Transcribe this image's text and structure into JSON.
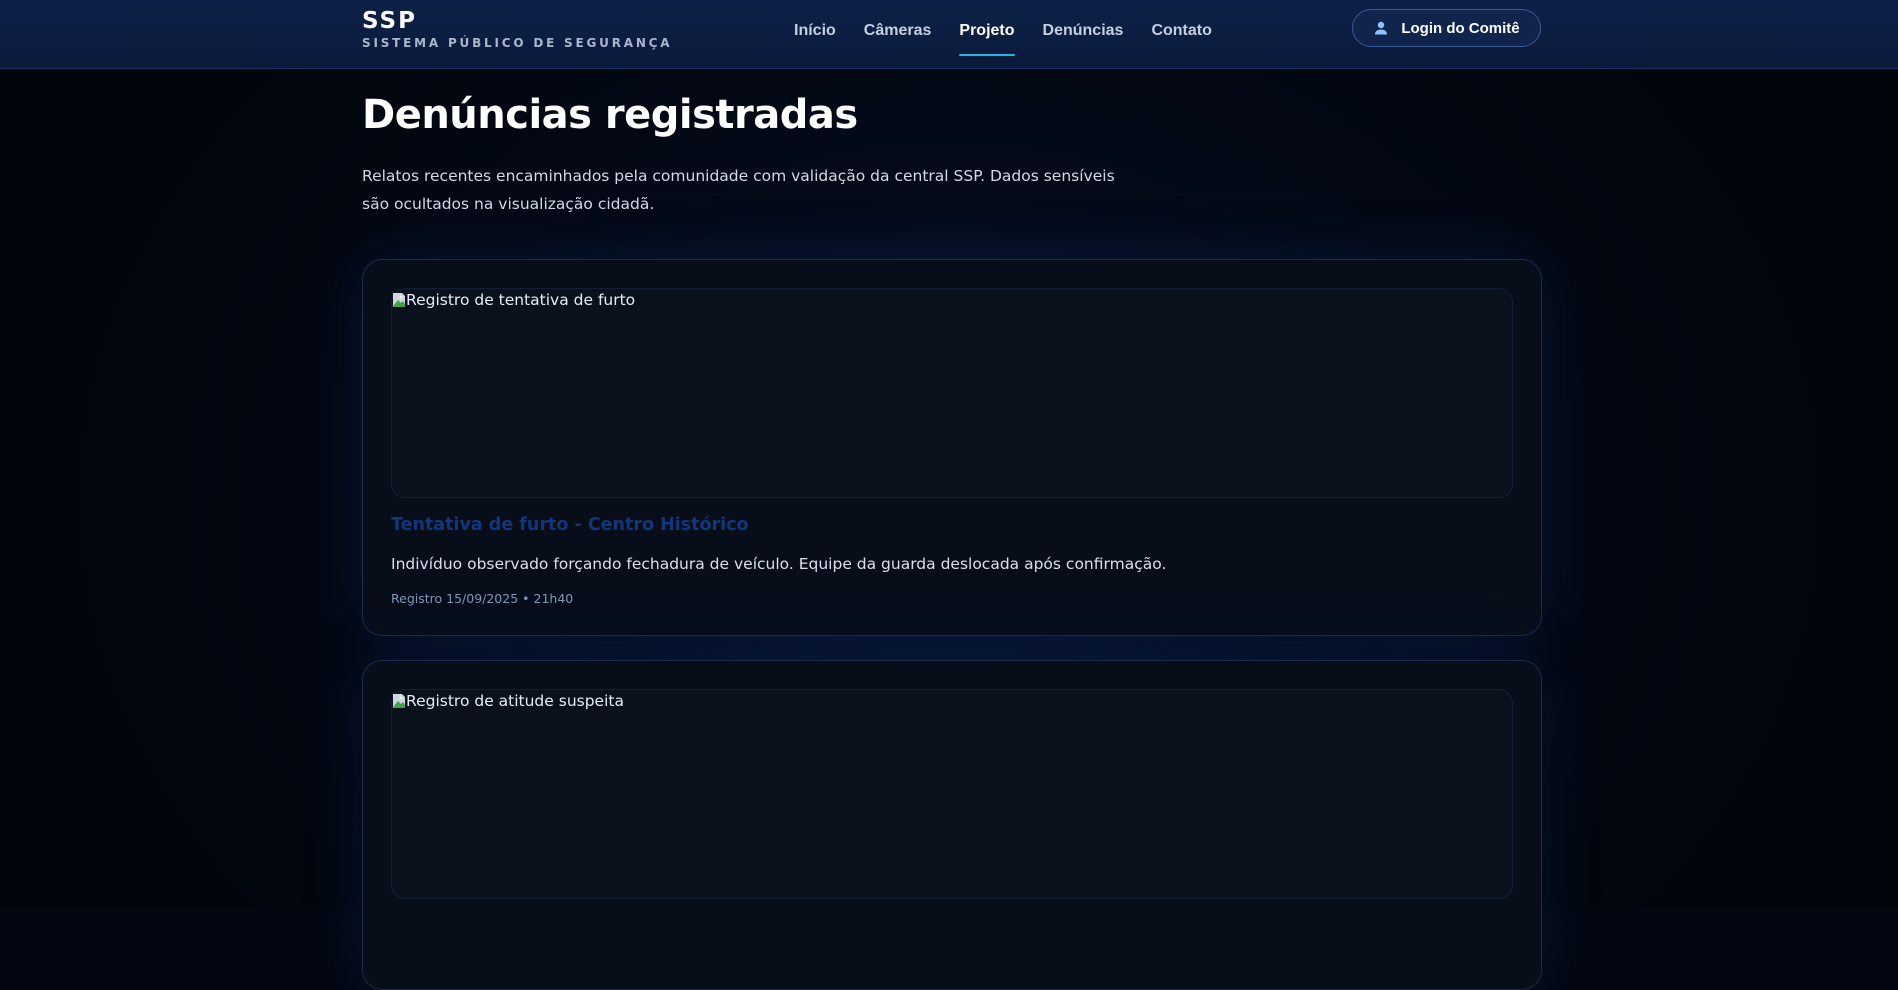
{
  "brand": {
    "title": "SSP",
    "subtitle": "SISTEMA PÚBLICO DE SEGURANÇA"
  },
  "nav": {
    "items": [
      {
        "label": "Início",
        "active": false
      },
      {
        "label": "Câmeras",
        "active": false
      },
      {
        "label": "Projeto",
        "active": true
      },
      {
        "label": "Denúncias",
        "active": false
      },
      {
        "label": "Contato",
        "active": false
      }
    ]
  },
  "login": {
    "label": "Login do Comitê",
    "icon": "user-icon"
  },
  "main": {
    "title": "Denúncias registradas",
    "description": "Relatos recentes encaminhados pela comunidade com validação da central SSP. Dados sensíveis são ocultados na visualização cidadã."
  },
  "reports": [
    {
      "image_alt": "Registro de tentativa de furto",
      "title": "Tentativa de furto - Centro Histórico",
      "text": "Indivíduo observado forçando fechadura de veículo. Equipe da guarda deslocada após confirmação.",
      "meta": "Registro 15/09/2025 • 21h40"
    },
    {
      "image_alt": "Registro de atitude suspeita"
    }
  ],
  "colors": {
    "accent": "#22b4e6",
    "header_bg": "#0d2148",
    "card_title": "#12367a",
    "page_bg": "#030711"
  }
}
